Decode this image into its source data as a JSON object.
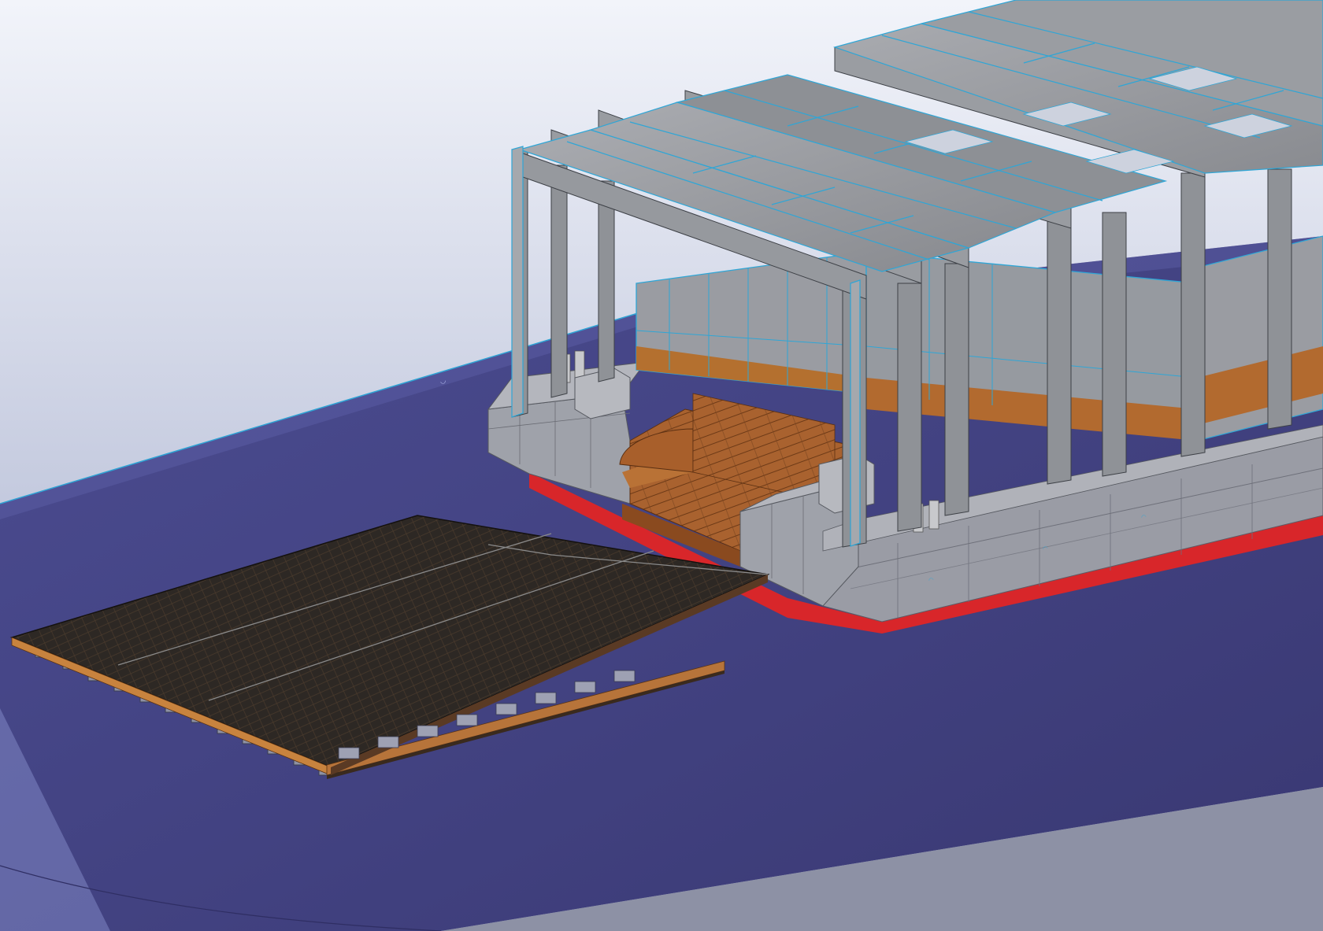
{
  "viewport": {
    "background_top": "#f2f4fa",
    "background_bottom": "#9aa3c4",
    "water": "#4a4a8e",
    "water_dark": "#36356f",
    "hull_grey": "#9ea1a8",
    "frame_grey": "#8e9196",
    "edge_blue": "#2fa6d6",
    "deck_wood": "#b06a35",
    "boot_red": "#d8262a",
    "pontoon_dark": "#2b2622"
  }
}
